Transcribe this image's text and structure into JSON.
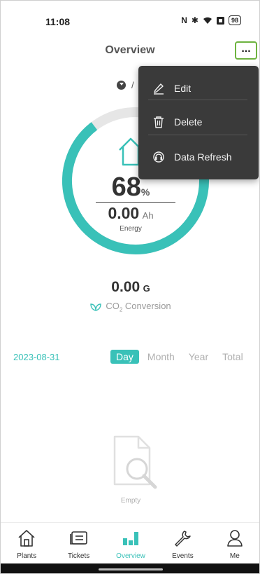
{
  "status_bar": {
    "time": "11:08",
    "battery": "98"
  },
  "header": {
    "title": "Overview"
  },
  "plant_selector": {
    "name": "/"
  },
  "gauge": {
    "percent_value": "68",
    "percent_unit": "%",
    "percent_level": 0.68,
    "energy_value": "0.00",
    "energy_unit": "Ah",
    "energy_label": "Energy"
  },
  "co2": {
    "value": "0.00",
    "unit": "G",
    "label_prefix": "CO",
    "label_sub": "2",
    "label_suffix": " Conversion"
  },
  "period": {
    "date": "2023-08-31",
    "tabs": [
      "Day",
      "Month",
      "Year",
      "Total"
    ],
    "active_tab": "Day"
  },
  "empty_state": {
    "text": "Empty"
  },
  "menu": {
    "items": [
      {
        "label": "Edit",
        "icon": "pencil-icon"
      },
      {
        "label": "Delete",
        "icon": "trash-icon"
      },
      {
        "label": "Data Refresh",
        "icon": "headset-icon"
      }
    ]
  },
  "bottom_nav": {
    "items": [
      {
        "label": "Plants",
        "icon": "house-icon"
      },
      {
        "label": "Tickets",
        "icon": "ticket-icon"
      },
      {
        "label": "Overview",
        "icon": "bar-chart-icon"
      },
      {
        "label": "Events",
        "icon": "wrench-icon"
      },
      {
        "label": "Me",
        "icon": "person-icon"
      }
    ],
    "active": "Overview"
  },
  "colors": {
    "accent": "#39c1b8",
    "gauge_track": "#e6e6e6",
    "menu_bg": "#3a3a3a",
    "highlight": "#6db33f"
  }
}
